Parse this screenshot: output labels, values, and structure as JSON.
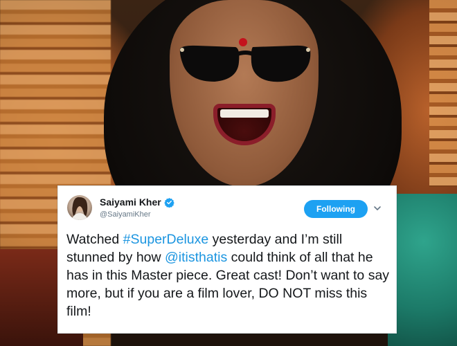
{
  "tweet": {
    "display_name": "Saiyami Kher",
    "handle": "@SaiyamiKher",
    "follow_label": "Following",
    "text_parts": {
      "p1": "Watched ",
      "hashtag": "#SuperDeluxe",
      "p2": " yesterday and I’m still stunned by how ",
      "mention": "@itisthatis",
      "p3": " could think of all that he has in this Master piece. Great cast! Don’t want to say more, but if you are a film lover, DO NOT miss this film!"
    },
    "icons": {
      "verified": "verified-badge-icon",
      "menu": "chevron-down-icon"
    },
    "colors": {
      "accent": "#1da1f2",
      "link": "#1b95e0",
      "text": "#14171a",
      "muted": "#657786"
    }
  }
}
